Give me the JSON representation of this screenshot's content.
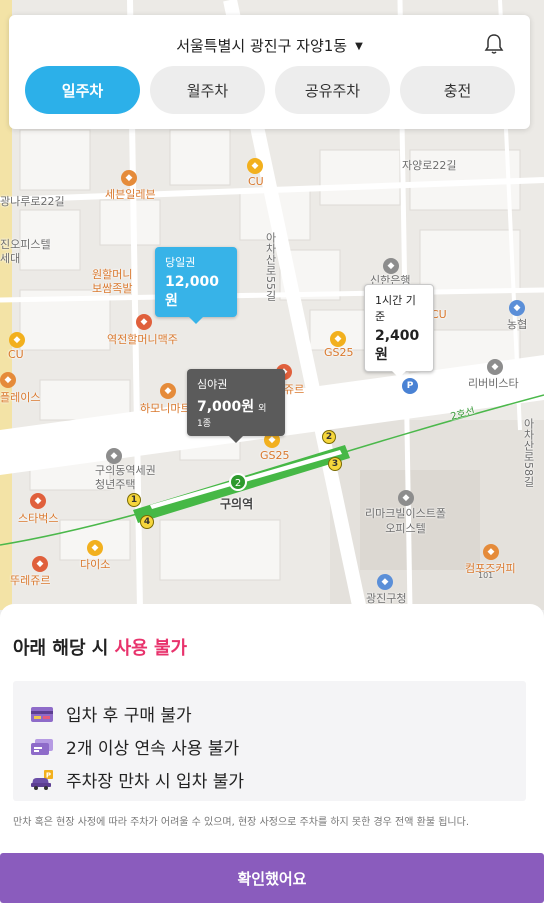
{
  "header": {
    "location": "서울특별시 광진구 자양1동",
    "caret_icon": "caret-down-icon",
    "bell_icon": "bell-icon",
    "tabs": [
      {
        "label": "일주차",
        "active": true
      },
      {
        "label": "월주차",
        "active": false
      },
      {
        "label": "공유주차",
        "active": false
      },
      {
        "label": "충전",
        "active": false
      }
    ]
  },
  "map": {
    "labels": {
      "seven_eleven": "세븐일레븐",
      "cu1": "CU",
      "cu2": "CU",
      "cu3": "CU",
      "jayangro22": "자양로22길",
      "gwangnaru22": "광나루로22길",
      "jin_officetel": "진오피스텔",
      "sede": "세대",
      "wonhalmeoni": "원할머니\n보쌈족발",
      "yeokjeon": "역전할머니맥주",
      "achasanro55": "아차산로55길",
      "sinhan": "신한은행",
      "nonghyup": "농협",
      "gs25_1": "GS25",
      "gs25_2": "GS25",
      "gongyeong": "공영",
      "ribabista": "리버비스타",
      "harmony": "하모니마트",
      "jyure": "쥬르",
      "place": "플레이스",
      "guui_officetel": "구의동역세권\n청년주택",
      "guui_station": "구의역",
      "line2": "2호선",
      "achasanro58": "아차산로58길",
      "starbucks": "스타벅스",
      "daiso": "다이소",
      "ddure": "뚜레쥬르",
      "rimark": "리마크빌이스트폴\n오피스텔",
      "compose": "컴포즈커피",
      "gugu_office": "광진구청",
      "gu101": "101"
    },
    "tags": [
      {
        "kind": "blue",
        "title": "당일권",
        "price": "12,000원",
        "extra": ""
      },
      {
        "kind": "dark",
        "title": "심야권",
        "price": "7,000원",
        "extra": "외 1종"
      },
      {
        "kind": "white",
        "title": "1시간 기준",
        "price": "2,400원",
        "extra": ""
      }
    ],
    "line_color": "#4bb84b"
  },
  "sheet": {
    "title_prefix": "아래 해당 시 ",
    "title_highlight": "사용 불가",
    "rules": [
      {
        "icon": "credit-card-icon",
        "text": "입차 후 구매 불가"
      },
      {
        "icon": "ticket-icon",
        "text": "2개 이상 연속 사용 불가"
      },
      {
        "icon": "parked-car-icon",
        "text": "주차장 만차 시 입차 불가"
      }
    ],
    "notice": "만차 혹은 현장 사정에 따라 주차가 어려울 수 있으며, 현장 사정으로 주차를 하지 못한 경우 전액 환불 됩니다.",
    "confirm_label": "확인했어요",
    "accent": "#8a5cbd",
    "highlight_color": "#e8336c"
  }
}
